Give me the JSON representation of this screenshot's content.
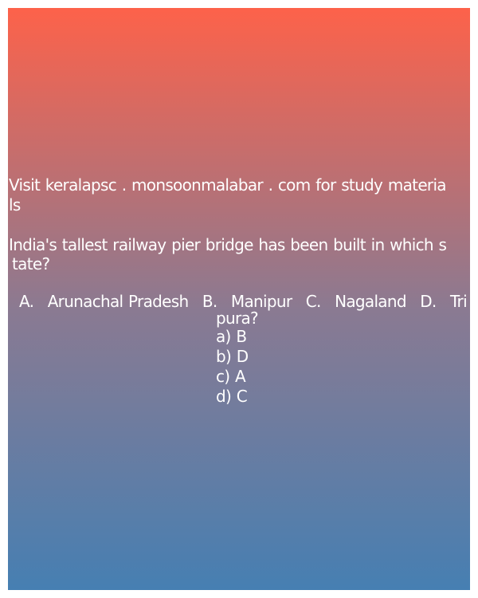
{
  "source": {
    "line1": "Visit keralapsc . monsoonmalabar . com for study materia",
    "line2": "ls"
  },
  "question": {
    "line1": "India's tallest railway pier bridge has been built in which s",
    "line2": "tate?"
  },
  "options": {
    "tokens": [
      "A.",
      "Arunachal Pradesh",
      "B.",
      "Manipur",
      "C.",
      "Nagaland",
      "D.",
      "Tri"
    ],
    "continuation": "pura?"
  },
  "answers": [
    "a) B",
    "b) D",
    "c) A",
    "d) C"
  ]
}
